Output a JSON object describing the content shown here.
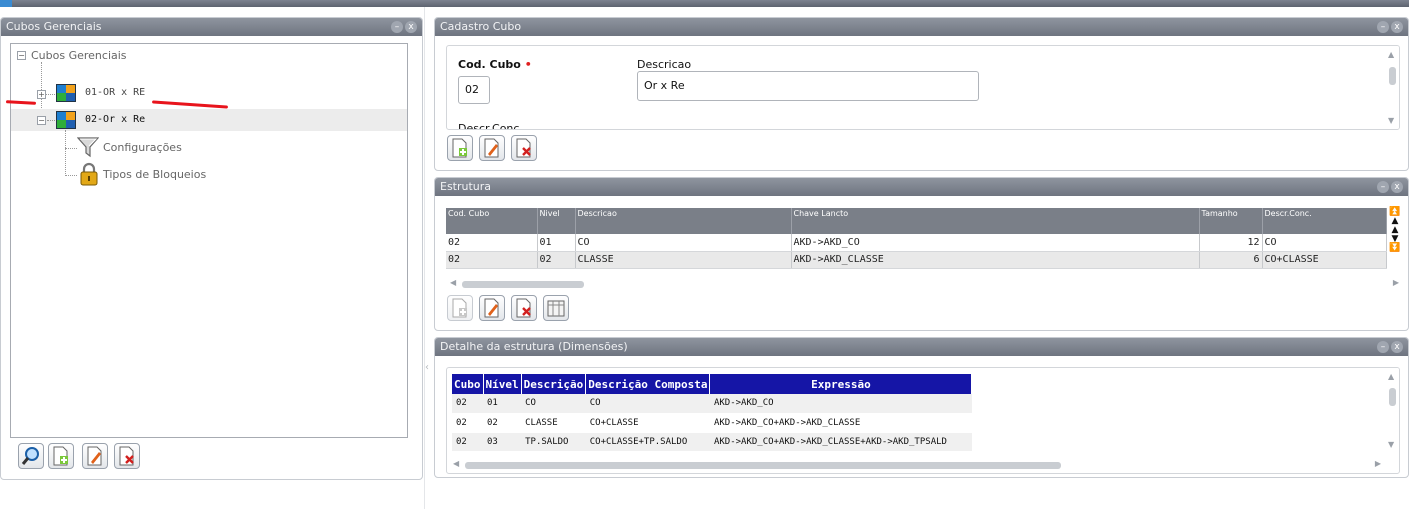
{
  "left_panel": {
    "title": "Cubos Gerenciais",
    "tree": {
      "root": {
        "label": "Cubos Gerenciais",
        "expander": "⊟"
      },
      "items": [
        {
          "label": "01-OR x RE",
          "expander": "⊞"
        },
        {
          "label": "02-Or x Re",
          "expander": "⊟"
        }
      ],
      "children": [
        {
          "label": "Configurações",
          "icon": "funnel-icon"
        },
        {
          "label": "Tipos de Bloqueios",
          "icon": "lock-icon"
        }
      ]
    },
    "buttons": [
      "search-button",
      "new-button",
      "edit-button",
      "delete-button"
    ]
  },
  "panel_controls": {
    "minimize": "–",
    "close": "x"
  },
  "cadastro": {
    "title": "Cadastro Cubo",
    "cod_label": "Cod. Cubo",
    "required_mark": "•",
    "cod_value": "02",
    "descricao_label": "Descricao",
    "descricao_value": "Or x Re",
    "descr_conc_label": "Descr.Conc."
  },
  "estrutura": {
    "title": "Estrutura",
    "columns": [
      "Cod. Cubo",
      "Nivel",
      "Descricao",
      "Chave Lancto",
      "Tamanho",
      "Descr.Conc."
    ],
    "rows": [
      [
        "02",
        "01",
        "CO",
        "AKD->AKD_CO",
        "12",
        "CO"
      ],
      [
        "02",
        "02",
        "CLASSE",
        "AKD->AKD_CLASSE",
        "6",
        "CO+CLASSE"
      ]
    ]
  },
  "detalhe": {
    "title": "Detalhe da estrutura (Dimensões)",
    "columns": [
      "Cubo",
      "Nível",
      "Descrição",
      "Descrição Composta",
      "Expressão"
    ],
    "rows": [
      [
        "02",
        "01",
        "CO",
        "CO",
        "AKD->AKD_CO"
      ],
      [
        "02",
        "02",
        "CLASSE",
        "CO+CLASSE",
        "AKD->AKD_CO+AKD->AKD_CLASSE"
      ],
      [
        "02",
        "03",
        "TP.SALDO",
        "CO+CLASSE+TP.SALDO",
        "AKD->AKD_CO+AKD->AKD_CLASSE+AKD->AKD_TPSALD"
      ]
    ]
  },
  "colors": {
    "header_gradient": "#7a808b",
    "grid_header": "#7a7f88",
    "detail_header": "#1515a6",
    "annotation": "#e8141c"
  }
}
